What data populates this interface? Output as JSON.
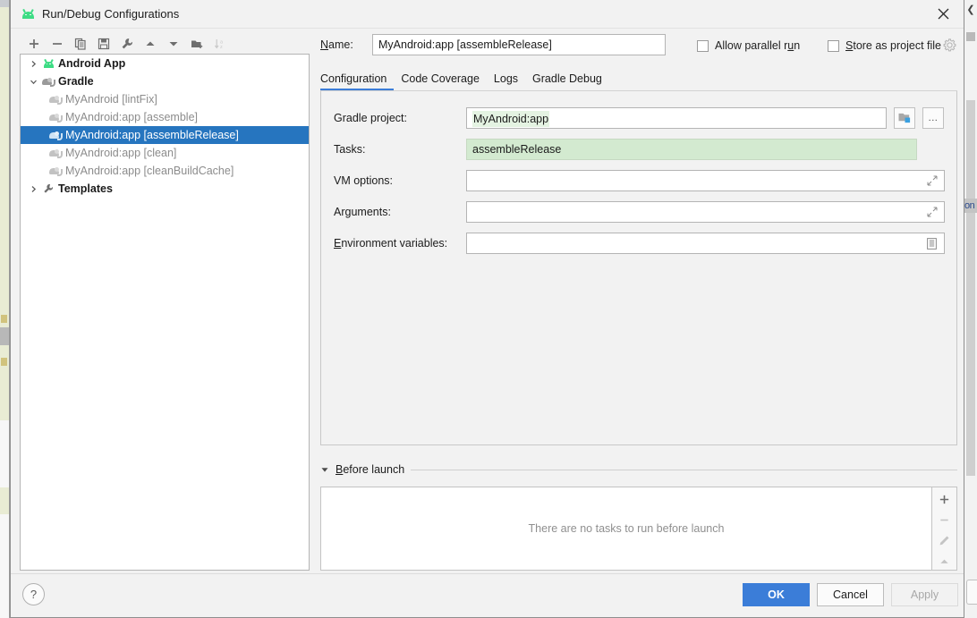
{
  "window": {
    "title": "Run/Debug Configurations",
    "app_icon": "android-robot-icon",
    "close_label": "✕"
  },
  "toolbar": {
    "buttons": [
      {
        "name": "add",
        "label": "+",
        "icon": "plus-icon",
        "disabled": false
      },
      {
        "name": "remove",
        "label": "−",
        "icon": "minus-icon",
        "disabled": false
      },
      {
        "name": "copy",
        "label": "Copy Configuration",
        "icon": "copy-icon",
        "disabled": false
      },
      {
        "name": "save",
        "label": "Save Configuration",
        "icon": "save-icon",
        "disabled": false
      },
      {
        "name": "edit-templates",
        "label": "Edit Templates",
        "icon": "wrench-icon",
        "disabled": false
      },
      {
        "name": "move-up",
        "label": "Move Up",
        "icon": "arrow-up-icon",
        "disabled": false
      },
      {
        "name": "move-down",
        "label": "Move Down",
        "icon": "arrow-down-icon",
        "disabled": false
      },
      {
        "name": "new-folder",
        "label": "Create New Folder",
        "icon": "folder-add-icon",
        "disabled": false
      },
      {
        "name": "sort",
        "label": "Sort Configurations",
        "icon": "sort-az-icon",
        "disabled": true
      }
    ]
  },
  "tree": {
    "nodes": [
      {
        "label": "Android App",
        "level": 0,
        "expandable": true,
        "expanded": false,
        "icon": "android-robot-icon",
        "bold": true,
        "muted": false,
        "selected": false
      },
      {
        "label": "Gradle",
        "level": 0,
        "expandable": true,
        "expanded": true,
        "icon": "gradle-elephant-icon",
        "bold": true,
        "muted": false,
        "selected": false
      },
      {
        "label": "MyAndroid [lintFix]",
        "level": 1,
        "expandable": false,
        "expanded": false,
        "icon": "gradle-elephant-icon",
        "bold": false,
        "muted": true,
        "selected": false
      },
      {
        "label": "MyAndroid:app [assemble]",
        "level": 1,
        "expandable": false,
        "expanded": false,
        "icon": "gradle-elephant-icon",
        "bold": false,
        "muted": true,
        "selected": false
      },
      {
        "label": "MyAndroid:app [assembleRelease]",
        "level": 1,
        "expandable": false,
        "expanded": false,
        "icon": "gradle-elephant-icon",
        "bold": false,
        "muted": false,
        "selected": true
      },
      {
        "label": "MyAndroid:app [clean]",
        "level": 1,
        "expandable": false,
        "expanded": false,
        "icon": "gradle-elephant-icon",
        "bold": false,
        "muted": true,
        "selected": false
      },
      {
        "label": "MyAndroid:app [cleanBuildCache]",
        "level": 1,
        "expandable": false,
        "expanded": false,
        "icon": "gradle-elephant-icon",
        "bold": false,
        "muted": true,
        "selected": false
      },
      {
        "label": "Templates",
        "level": 0,
        "expandable": true,
        "expanded": false,
        "icon": "wrench-icon",
        "bold": true,
        "muted": false,
        "selected": false
      }
    ]
  },
  "name_field": {
    "label_prefix": "",
    "label_mnemonic": "N",
    "label_suffix": "ame:",
    "value": "MyAndroid:app [assembleRelease]",
    "placeholder": ""
  },
  "options": {
    "allow_parallel_run": {
      "prefix": "Allow parallel r",
      "mnemonic": "u",
      "suffix": "n",
      "checked": false
    },
    "store_as_project_file": {
      "prefix": "",
      "mnemonic": "S",
      "suffix": "tore as project file",
      "checked": false
    },
    "gear_icon": "gear-icon"
  },
  "tabs": [
    {
      "label": "Configuration",
      "active": true
    },
    {
      "label": "Code Coverage",
      "active": false
    },
    {
      "label": "Logs",
      "active": false
    },
    {
      "label": "Gradle Debug",
      "active": false
    }
  ],
  "config_form": {
    "gradle_project": {
      "label": "Gradle project:",
      "value": "MyAndroid:app",
      "value_highlight_color": "#e4f3e2",
      "module_button_icon": "module-folder-icon",
      "browse_button_label": "..."
    },
    "tasks": {
      "label": "Tasks:",
      "value": "assembleRelease",
      "background_color": "#d3ead0"
    },
    "vm_options": {
      "label": "VM options:",
      "value": "",
      "expand_icon": "expand-arrows-icon"
    },
    "arguments": {
      "label": "Arguments:",
      "value": "",
      "expand_icon": "expand-arrows-icon"
    },
    "environment_variables": {
      "label_prefix": "",
      "label_mnemonic": "E",
      "label_suffix": "nvironment variables:",
      "value": "",
      "edit_icon": "list-edit-icon"
    }
  },
  "before_launch": {
    "title_prefix": "",
    "title_mnemonic": "B",
    "title_suffix": "efore launch",
    "collapse_icon": "triangle-down-icon",
    "expanded": true,
    "empty_message": "There are no tasks to run before launch",
    "side_buttons": [
      {
        "name": "add-task",
        "icon": "plus-icon",
        "disabled": false
      },
      {
        "name": "remove-task",
        "icon": "minus-icon",
        "disabled": true
      },
      {
        "name": "edit-task",
        "icon": "pencil-icon",
        "disabled": true
      },
      {
        "name": "move-task-up",
        "icon": "triangle-up-icon",
        "disabled": true
      }
    ]
  },
  "footer": {
    "help_label": "?",
    "ok_label": "OK",
    "cancel_label": "Cancel",
    "apply_label": "Apply",
    "apply_disabled": true,
    "ok_color": "#3b7dd8"
  },
  "background": {
    "right_edge_text": "on"
  }
}
